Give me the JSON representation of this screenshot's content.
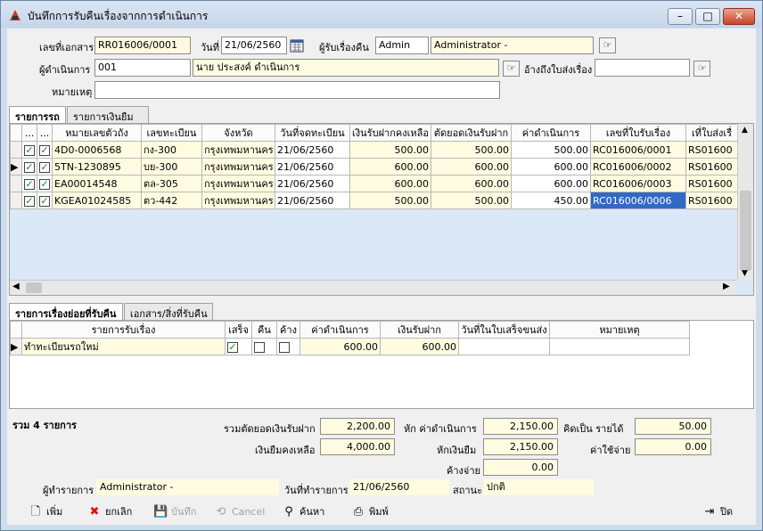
{
  "window": {
    "title": "บันทึกการรับคืนเรื่องจากการดำเนินการ",
    "min": "–",
    "max": "□",
    "close": "✕"
  },
  "header": {
    "doc_no_label": "เลขที่เอกสาร",
    "doc_no": "RR016006/0001",
    "date_label": "วันที่",
    "date": "21/06/2560",
    "receiver_label": "ผู้รับเรื่องคืน",
    "receiver_code": "Admin",
    "receiver_name": "Administrator -",
    "operator_label": "ผู้ดำเนินการ",
    "operator_code": "001",
    "operator_name": "นาย ประสงค์ ดำเนินการ",
    "ref_label": "อ้างถึงใบส่งเรื่อง",
    "ref_value": "",
    "note_label": "หมายเหตุ",
    "note_value": ""
  },
  "tabs_top": [
    {
      "label": "รายการรถ"
    },
    {
      "label": "รายการเงินยืม"
    }
  ],
  "grid1": {
    "columns": [
      "...",
      "...",
      "หมายเลขตัวถัง",
      "เลขทะเบียน",
      "จังหวัด",
      "วันที่จดทะเบียน",
      "เงินรับฝากคงเหลือ",
      "ตัดยอดเงินรับฝาก",
      "ค่าดำเนินการ",
      "เลขที่ใบรับเรื่อง",
      "เที่ใบส่งเรื่"
    ],
    "rows": [
      {
        "c1": "✓",
        "c2": "✓",
        "chassis": "4D0-0006568",
        "plate": "กง-300",
        "province": "กรุงเทพมหานคร",
        "reg_date": "21/06/2560",
        "deposit": "500.00",
        "deduct": "500.00",
        "fee": "500.00",
        "receipt": "RC016006/0001",
        "send": "RS01600"
      },
      {
        "c1": "✓",
        "c2": "✓",
        "chassis": "5TN-1230895",
        "plate": "บย-300",
        "province": "กรุงเทพมหานคร",
        "reg_date": "21/06/2560",
        "deposit": "600.00",
        "deduct": "600.00",
        "fee": "600.00",
        "receipt": "RC016006/0002",
        "send": "RS01600"
      },
      {
        "c1": "✓",
        "c2": "✓",
        "chassis": "EA00014548",
        "plate": "ตล-305",
        "province": "กรุงเทพมหานคร",
        "reg_date": "21/06/2560",
        "deposit": "600.00",
        "deduct": "600.00",
        "fee": "600.00",
        "receipt": "RC016006/0003",
        "send": "RS01600"
      },
      {
        "c1": "✓",
        "c2": "✓",
        "chassis": "KGEA01024585",
        "plate": "ตว-442",
        "province": "กรุงเทพมหานคร",
        "reg_date": "21/06/2560",
        "deposit": "500.00",
        "deduct": "500.00",
        "fee": "450.00",
        "receipt": "RC016006/0006",
        "send": "RS01600"
      }
    ]
  },
  "tabs_bottom": [
    {
      "label": "รายการเรื่องย่อยที่รับคืน"
    },
    {
      "label": "เอกสาร/สิ่งที่รับคืน"
    }
  ],
  "grid2": {
    "columns": [
      "รายการรับเรื่อง",
      "เสร็จ",
      "คืน",
      "ค้าง",
      "ค่าดำเนินการ",
      "เงินรับฝาก",
      "วันที่ในใบเสร็จขนส่ง",
      "หมายเหตุ"
    ],
    "rows": [
      {
        "item": "ทำทะเบียนรถใหม่",
        "done": "✓",
        "return": "",
        "pending": "",
        "fee": "600.00",
        "deposit": "600.00",
        "receipt_date": "",
        "note": ""
      }
    ]
  },
  "summary": {
    "count_label": "รวม 4 รายการ",
    "deduct_label": "รวมตัดยอดเงินรับฝาก",
    "deduct": "2,200.00",
    "fee_label": "หัก ค่าดำเนินการ",
    "fee": "2,150.00",
    "income_label": "คิดเป็น  รายได้",
    "income": "50.00",
    "loan_label": "เงินยืมคงเหลือ",
    "loan": "4,000.00",
    "loan_deduct_label": "หักเงินยืม",
    "loan_deduct": "2,150.00",
    "expense_label": "ค่าใช้จ่าย",
    "expense": "0.00",
    "pending_label": "ค้างจ่าย",
    "pending": "0.00"
  },
  "status": {
    "creator_label": "ผู้ทำรายการ",
    "creator": "Administrator -",
    "date_label": "วันที่ทำรายการ",
    "date": "21/06/2560",
    "state_label": "สถานะ",
    "state": "ปกติ"
  },
  "toolbar": {
    "add": "เพิ่ม",
    "cancel_doc": "ยกเลิก",
    "save": "บันทึก",
    "cancel": "Cancel",
    "search": "ค้นหา",
    "print": "พิมพ์",
    "close": "ปิด"
  }
}
